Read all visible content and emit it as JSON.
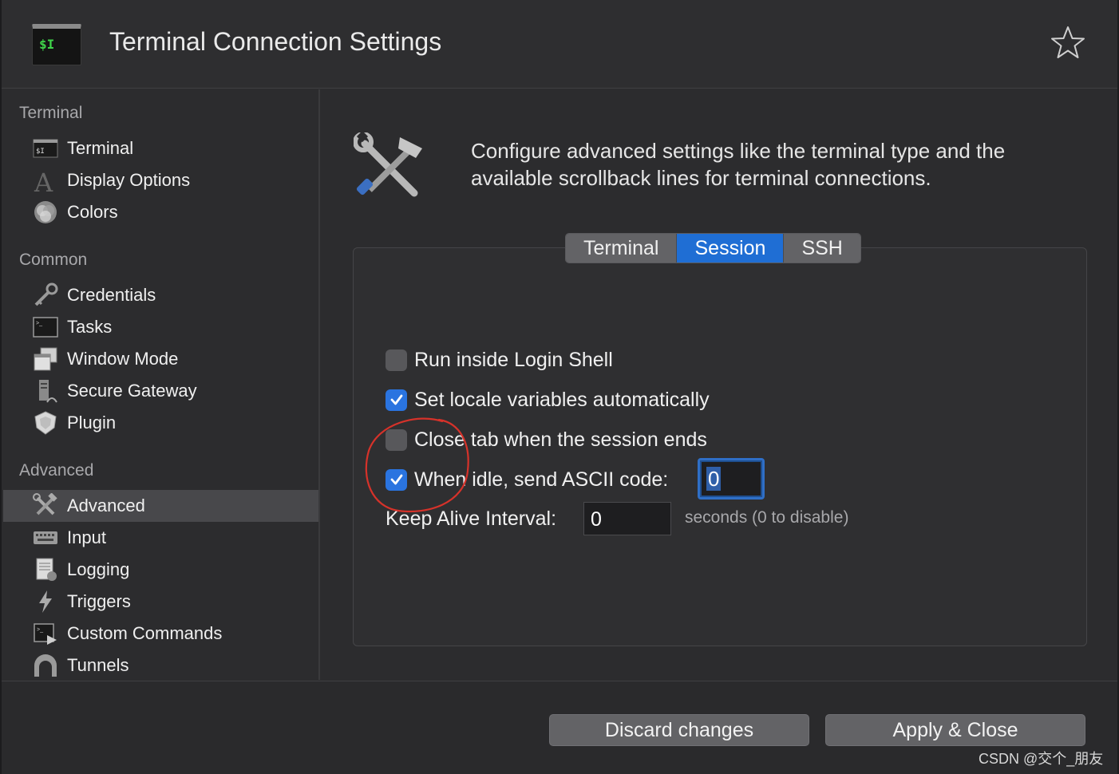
{
  "window": {
    "title": "Terminal Connection Settings",
    "app_icon_text": "$I"
  },
  "sidebar": {
    "groups": [
      {
        "title": "Terminal",
        "items": [
          {
            "label": "Terminal",
            "icon": "terminal-icon"
          },
          {
            "label": "Display Options",
            "icon": "font-icon"
          },
          {
            "label": "Colors",
            "icon": "colors-icon"
          }
        ]
      },
      {
        "title": "Common",
        "items": [
          {
            "label": "Credentials",
            "icon": "key-icon"
          },
          {
            "label": "Tasks",
            "icon": "tasks-icon"
          },
          {
            "label": "Window Mode",
            "icon": "window-mode-icon"
          },
          {
            "label": "Secure Gateway",
            "icon": "gateway-icon"
          },
          {
            "label": "Plugin",
            "icon": "plugin-icon"
          }
        ]
      },
      {
        "title": "Advanced",
        "items": [
          {
            "label": "Advanced",
            "icon": "tools-icon",
            "active": true
          },
          {
            "label": "Input",
            "icon": "keyboard-icon"
          },
          {
            "label": "Logging",
            "icon": "logging-icon"
          },
          {
            "label": "Triggers",
            "icon": "triggers-icon"
          },
          {
            "label": "Custom Commands",
            "icon": "custom-commands-icon"
          },
          {
            "label": "Tunnels",
            "icon": "tunnels-icon"
          }
        ]
      }
    ]
  },
  "main": {
    "description": "Configure advanced settings like the terminal type and the available scrollback lines for terminal connections.",
    "tabs": [
      {
        "label": "Terminal",
        "selected": false
      },
      {
        "label": "Session",
        "selected": true
      },
      {
        "label": "SSH",
        "selected": false
      }
    ],
    "options": [
      {
        "label": "Run inside Login Shell",
        "checked": false
      },
      {
        "label": "Set locale variables automatically",
        "checked": true
      },
      {
        "label": "Close tab when the session ends",
        "checked": false
      },
      {
        "label": "When idle, send ASCII code:",
        "checked": true
      }
    ],
    "ascii_code_value": "0",
    "keep_alive": {
      "label": "Keep Alive Interval:",
      "value": "0",
      "hint": "seconds (0 to disable)"
    }
  },
  "footer": {
    "discard_label": "Discard changes",
    "apply_label": "Apply & Close"
  },
  "watermark": "CSDN @交个_朋友",
  "colors": {
    "accent": "#1f6ed4",
    "checkbox_checked": "#2a74e0",
    "annotation": "#d6322a"
  }
}
